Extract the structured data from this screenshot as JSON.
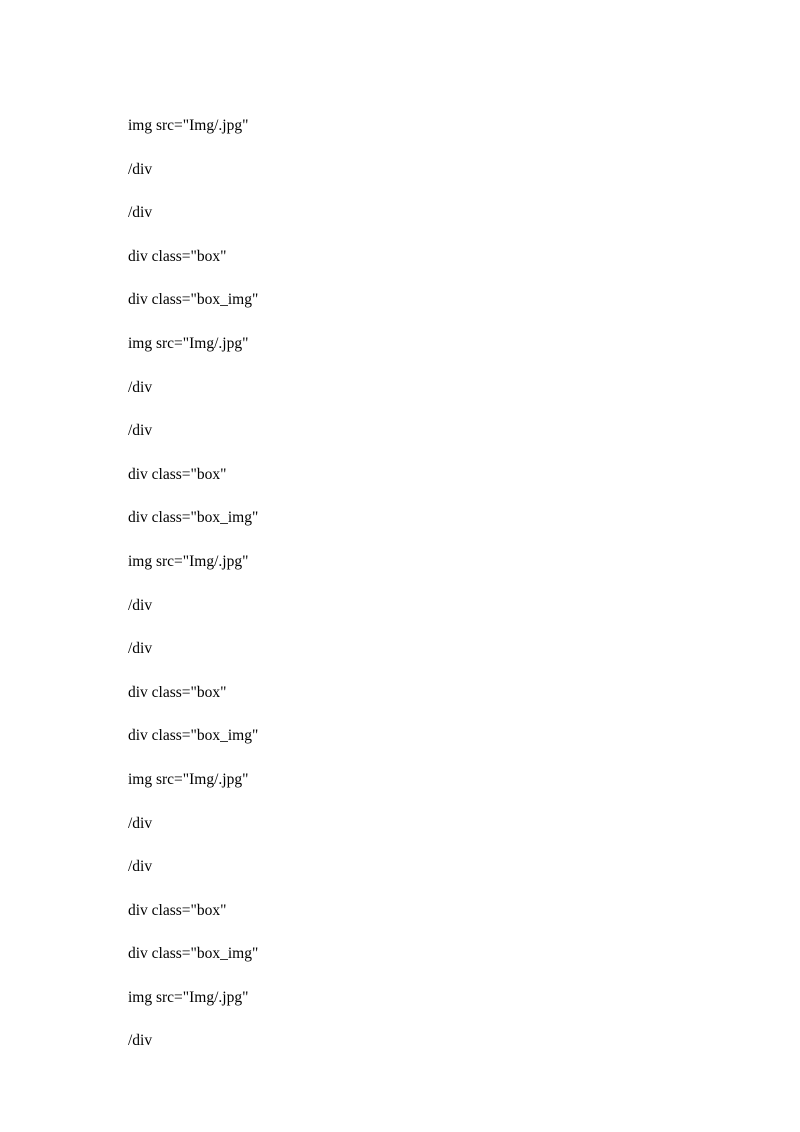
{
  "lines": [
    "img src=\"Img/.jpg\"",
    "/div",
    "/div",
    "div class=\"box\"",
    "div class=\"box_img\"",
    "img src=\"Img/.jpg\"",
    "/div",
    "/div",
    "div class=\"box\"",
    "div class=\"box_img\"",
    "img src=\"Img/.jpg\"",
    "/div",
    "/div",
    "div class=\"box\"",
    "div class=\"box_img\"",
    "img src=\"Img/.jpg\"",
    "/div",
    "/div",
    "div class=\"box\"",
    "div class=\"box_img\"",
    "img src=\"Img/.jpg\"",
    "/div"
  ]
}
